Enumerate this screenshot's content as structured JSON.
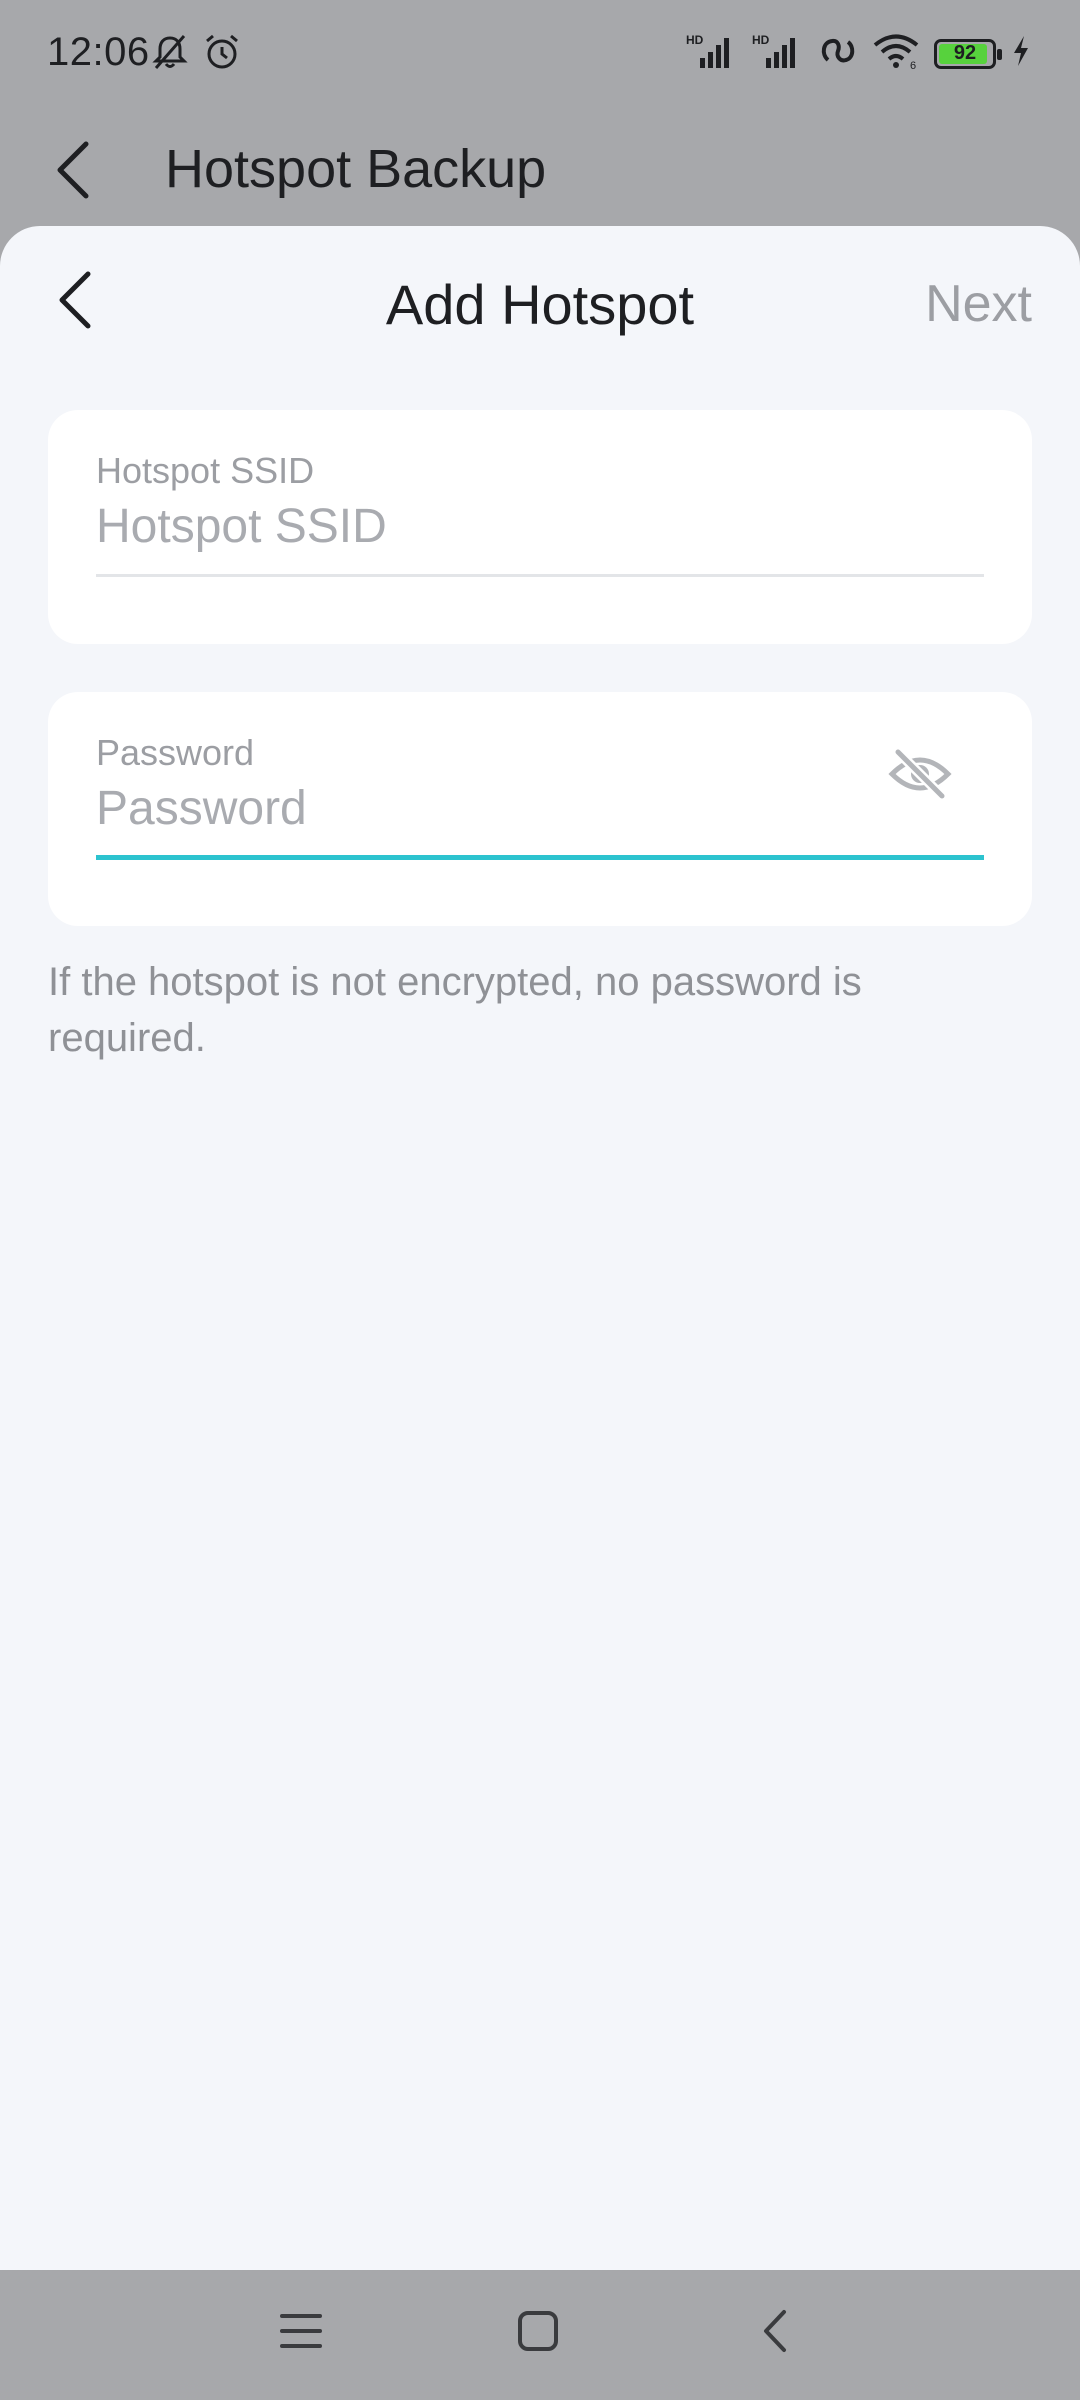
{
  "status_bar": {
    "time": "12:06",
    "battery_level": "92",
    "battery_fraction": 0.92,
    "icons": [
      "bell-off-icon",
      "alarm-icon",
      "hd-signal-icon",
      "hd-signal-icon",
      "hotspot-link-icon",
      "wifi-icon",
      "battery-icon",
      "charging-icon"
    ],
    "battery_color": "#57d23d"
  },
  "background_screen": {
    "title": "Hotspot Backup"
  },
  "sheet": {
    "title": "Add Hotspot",
    "next_label": "Next",
    "ssid": {
      "label": "Hotspot SSID",
      "placeholder": "Hotspot SSID",
      "value": ""
    },
    "password": {
      "label": "Password",
      "placeholder": "Password",
      "value": "",
      "visibility_icon": "eye-off-icon"
    },
    "hint": "If the hotspot is not encrypted, no password is required."
  },
  "colors": {
    "accent": "#2cc3cf",
    "disabled_text": "#9c9ea3"
  },
  "nav_bar": {
    "icons": [
      "menu-icon",
      "home-square-icon",
      "back-chevron-icon"
    ]
  }
}
